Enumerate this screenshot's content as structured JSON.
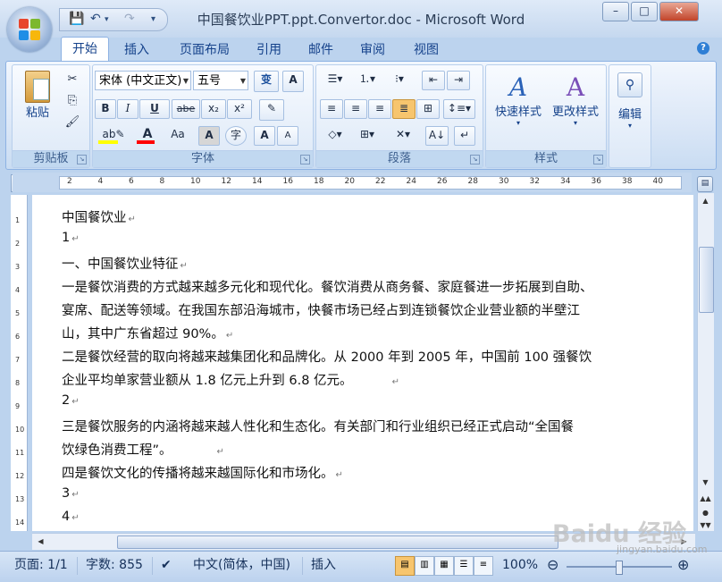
{
  "window": {
    "title": "中国餐饮业PPT.ppt.Convertor.doc - Microsoft Word",
    "minimize": "–",
    "maximize": "□",
    "close": "✕"
  },
  "qat": {
    "save_icon": "save-icon",
    "undo_icon": "undo-icon",
    "redo_icon": "redo-icon",
    "customize_icon": "dropdown-icon"
  },
  "tabs": [
    "开始",
    "插入",
    "页面布局",
    "引用",
    "邮件",
    "审阅",
    "视图"
  ],
  "ribbon": {
    "clipboard": {
      "label": "剪贴板",
      "paste": "粘贴"
    },
    "font": {
      "label": "字体",
      "font_name": "宋体 (中文正文)",
      "font_size": "五号",
      "bold": "B",
      "italic": "I",
      "underline": "U",
      "strike": "abe",
      "subscript": "x₂",
      "superscript": "x²",
      "change_case": "Aa",
      "grow": "A",
      "shrink": "A",
      "wen": "变",
      "char_border": "A"
    },
    "paragraph": {
      "label": "段落"
    },
    "styles": {
      "label": "样式",
      "quick_styles": "快速样式",
      "change_styles": "更改样式"
    },
    "editing": {
      "label": "编辑",
      "button": "编辑"
    }
  },
  "ruler": {
    "ticks": [
      "2",
      "4",
      "6",
      "8",
      "10",
      "12",
      "14",
      "16",
      "18",
      "20",
      "22",
      "24",
      "26",
      "28",
      "30",
      "32",
      "34",
      "36",
      "38",
      "40"
    ],
    "vticks": [
      "1",
      "2",
      "3",
      "4",
      "5",
      "6",
      "7",
      "8",
      "9",
      "10",
      "11",
      "12",
      "13",
      "14"
    ]
  },
  "document": {
    "lines": [
      "中国餐饮业",
      "1",
      "一、中国餐饮业特征",
      "一是餐饮消费的方式越来越多元化和现代化。餐饮消费从商务餐、家庭餐进一步拓展到自助、",
      "宴席、配送等领域。在我国东部沿海城市，快餐市场已经占到连锁餐饮企业营业额的半壁江",
      "山，其中广东省超过 90%。",
      "二是餐饮经营的取向将越来越集团化和品牌化。从 2000 年到 2005 年，中国前 100 强餐饮",
      "企业平均单家营业额从 1.8 亿元上升到 6.8 亿元。",
      "2",
      "三是餐饮服务的内涵将越来越人性化和生态化。有关部门和行业组织已经正式启动“全国餐",
      "饮绿色消费工程”。",
      "四是餐饮文化的传播将越来越国际化和市场化。",
      "3",
      "4"
    ]
  },
  "status": {
    "page": "页面: 1/1",
    "words": "字数: 855",
    "language": "中文(简体，中国)",
    "mode": "插入",
    "zoom": "100%"
  },
  "watermark": {
    "main": "Baidu 经验",
    "sub": "jingyan.baidu.com"
  },
  "colors": {
    "highlight": "#ffff00",
    "font_color": "#ff0000",
    "accent": "#15428b"
  }
}
